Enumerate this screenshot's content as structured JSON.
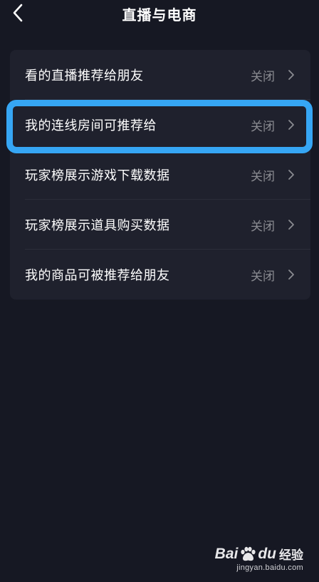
{
  "header": {
    "title": "直播与电商",
    "back_icon": "chevron-left-icon"
  },
  "settings": [
    {
      "label": "看的直播推荐给朋友",
      "value": "关闭",
      "highlighted": false
    },
    {
      "label": "我的连线房间可推荐给",
      "value": "关闭",
      "highlighted": true
    },
    {
      "label": "玩家榜展示游戏下载数据",
      "value": "关闭",
      "highlighted": false
    },
    {
      "label": "玩家榜展示道具购买数据",
      "value": "关闭",
      "highlighted": false
    },
    {
      "label": "我的商品可被推荐给朋友",
      "value": "关闭",
      "highlighted": false
    }
  ],
  "colors": {
    "background": "#161823",
    "card": "#1f212d",
    "highlight": "#36a6f4",
    "value_text": "#8a8b91"
  },
  "watermark": {
    "brand_left": "Bai",
    "brand_right": "du",
    "brand_cn": "经验",
    "url": "jingyan.baidu.com"
  }
}
